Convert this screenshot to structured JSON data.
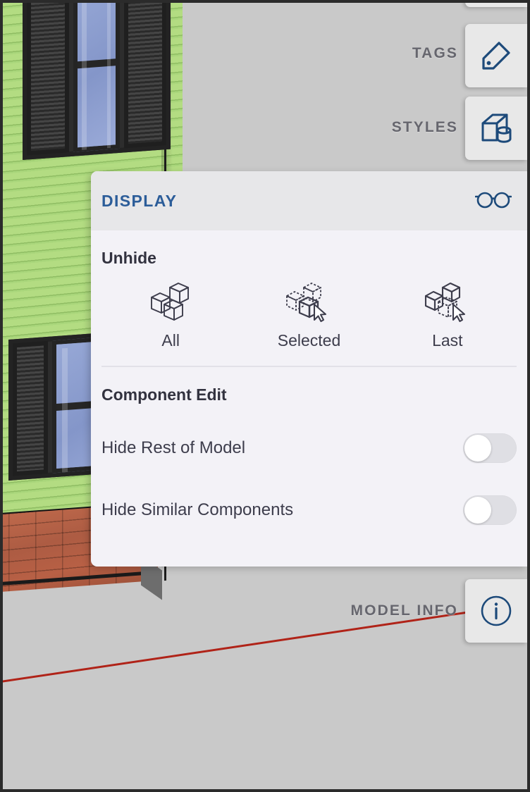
{
  "app": {
    "canvas_background_color": "#c9c9c9",
    "accent_color": "#2c5d99",
    "panel_background_color": "#f3f2f7",
    "axis_line_color": "#b02318"
  },
  "toolbar": {
    "buttons": [
      {
        "label": "",
        "icon": "partial-button-top",
        "interactable": true
      },
      {
        "label": "TAGS",
        "icon": "tag-icon",
        "interactable": true
      },
      {
        "label": "STYLES",
        "icon": "styles-icon",
        "interactable": true
      },
      {
        "label": "MODEL INFO",
        "icon": "info-icon",
        "interactable": true
      }
    ],
    "tags_label": "TAGS",
    "styles_label": "STYLES",
    "model_info_label": "MODEL INFO"
  },
  "display_panel": {
    "title": "DISPLAY",
    "header_icon": "glasses-icon",
    "unhide": {
      "section_title": "Unhide",
      "items": [
        {
          "label": "All",
          "icon": "cubes-solid-icon"
        },
        {
          "label": "Selected",
          "icon": "cubes-selected-icon"
        },
        {
          "label": "Last",
          "icon": "cubes-last-icon"
        }
      ]
    },
    "component_edit": {
      "section_title": "Component Edit",
      "toggles": [
        {
          "label": "Hide Rest of Model",
          "state": "off"
        },
        {
          "label": "Hide Similar Components",
          "state": "off"
        }
      ]
    }
  },
  "viewport": {
    "model_description": "3D model of a house wall with green clapboard siding, two shuttered windows and a brick foundation",
    "siding_color": "#a9d67b",
    "brick_color": "#ad5c43",
    "shutter_color": "#2a2a2a",
    "glass_color": "#8a9ccd"
  }
}
